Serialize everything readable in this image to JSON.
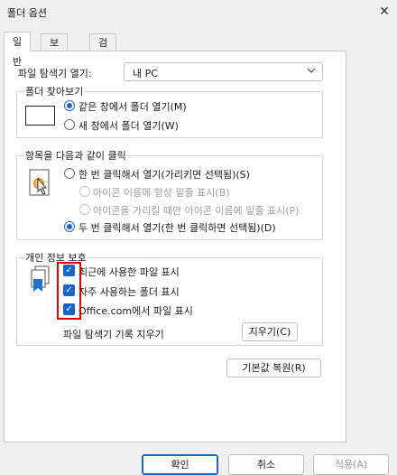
{
  "window": {
    "title": "폴더 옵션",
    "close_glyph": "✕"
  },
  "tabs": [
    {
      "label": "일반",
      "active": true
    },
    {
      "label": "보기",
      "active": false
    },
    {
      "label": "검색",
      "active": false
    }
  ],
  "explorer_open": {
    "label": "파일 탐색기 열기:",
    "value": "내 PC"
  },
  "browse_folders": {
    "legend": "폴더 찾아보기",
    "options": [
      {
        "label": "같은 창에서 폴더 열기(M)",
        "selected": true
      },
      {
        "label": "새 창에서 폴더 열기(W)",
        "selected": false
      }
    ]
  },
  "click_items": {
    "legend": "항목을 다음과 같이 클릭",
    "single_click": {
      "label": "한 번 클릭해서 열기(가리키면 선택됨)(S)",
      "selected": false
    },
    "underline_always": {
      "label": "아이콘 이름에 항상 밑줄 표시(B)",
      "enabled": false
    },
    "underline_hover": {
      "label": "아이콘을 가리킬 때만 아이콘 이름에 밑줄 표시(P)",
      "enabled": false
    },
    "double_click": {
      "label": "두 번 클릭해서 열기(한 번 클릭하면 선택됨)(D)",
      "selected": true
    }
  },
  "privacy": {
    "legend": "개인 정보 보호",
    "checkboxes": [
      {
        "label": "최근에 사용한 파일 표시",
        "checked": true
      },
      {
        "label": "자주 사용하는 폴더 표시",
        "checked": true
      },
      {
        "label": "Office.com에서 파일 표시",
        "checked": true
      }
    ],
    "clear_label": "파일 탐색기 기록 지우기",
    "clear_button": "지우기(C)"
  },
  "restore_defaults": "기본값 복원(R)",
  "footer": {
    "ok": "확인",
    "cancel": "취소",
    "apply": "적용(A)"
  },
  "colors": {
    "accent": "#1b63c6",
    "highlight": "#e00000",
    "panel_bg": "#ffffff",
    "window_bg": "#f0f0f0"
  }
}
